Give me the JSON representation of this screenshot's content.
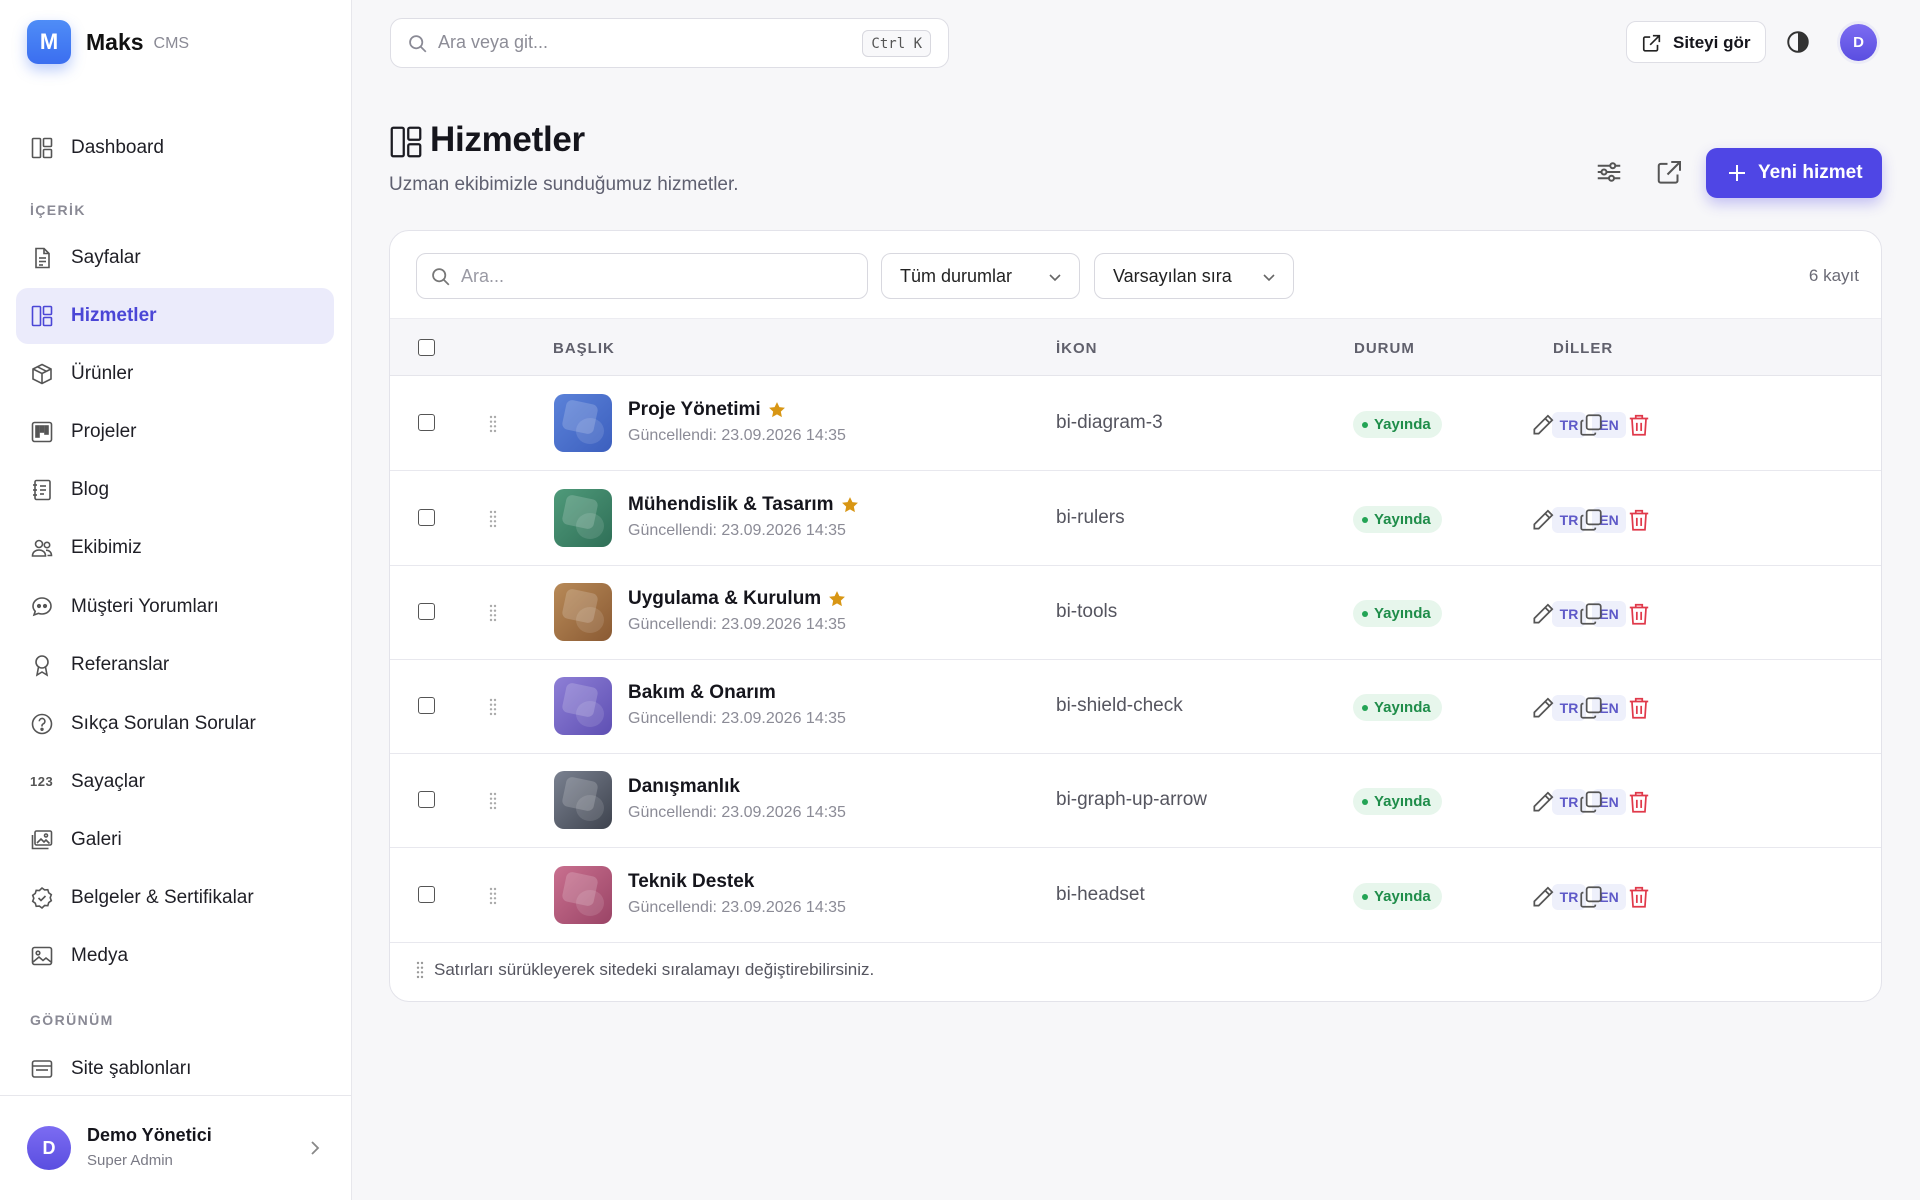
{
  "brand": {
    "logo_letter": "M",
    "name": "Maks",
    "sub": "CMS"
  },
  "sidebar": {
    "dashboard": "Dashboard",
    "section_content": "İÇERİK",
    "items": [
      {
        "label": "Sayfalar",
        "icon": "file-text-icon"
      },
      {
        "label": "Hizmetler",
        "icon": "layout-grid-icon",
        "active": true
      },
      {
        "label": "Ürünler",
        "icon": "box-icon"
      },
      {
        "label": "Projeler",
        "icon": "kanban-icon"
      },
      {
        "label": "Blog",
        "icon": "journal-icon"
      },
      {
        "label": "Ekibimiz",
        "icon": "people-icon"
      },
      {
        "label": "Müşteri Yorumları",
        "icon": "chat-quote-icon"
      },
      {
        "label": "Referanslar",
        "icon": "award-icon"
      },
      {
        "label": "Sıkça Sorulan Sorular",
        "icon": "question-circle-icon"
      },
      {
        "label": "Sayaçlar",
        "icon": "123-icon",
        "glyph": "123"
      },
      {
        "label": "Galeri",
        "icon": "images-icon"
      },
      {
        "label": "Belgeler & Sertifikalar",
        "icon": "patch-check-icon"
      },
      {
        "label": "Medya",
        "icon": "image-icon"
      }
    ],
    "section_view": "GÖRÜNÜM",
    "view_items": [
      {
        "label": "Site şablonları",
        "icon": "window-icon"
      }
    ]
  },
  "user": {
    "avatar": "D",
    "name": "Demo Yönetici",
    "role": "Super Admin"
  },
  "topbar": {
    "search_placeholder": "Ara veya git...",
    "shortcut": "Ctrl K",
    "view_site": "Siteyi gör",
    "avatar": "D"
  },
  "page": {
    "title": "Hizmetler",
    "subtitle": "Uzman ekibimizle sunduğumuz hizmetler.",
    "new_button": "Yeni hizmet"
  },
  "filters": {
    "search_placeholder": "Ara...",
    "status": "Tüm durumlar",
    "sort": "Varsayılan sıra",
    "count": "6 kayıt"
  },
  "table": {
    "columns": {
      "title": "BAŞLIK",
      "icon": "İKON",
      "status": "DURUM",
      "langs": "DİLLER"
    },
    "rows": [
      {
        "title": "Proje Yönetimi",
        "featured": true,
        "updated": "Güncellendi: 23.09.2026 14:35",
        "icon": "bi-diagram-3",
        "status": "Yayında",
        "langs": [
          "TR",
          "EN"
        ],
        "thumb": [
          "#5b82d9",
          "#3c5fbe"
        ]
      },
      {
        "title": "Mühendislik & Tasarım",
        "featured": true,
        "updated": "Güncellendi: 23.09.2026 14:35",
        "icon": "bi-rulers",
        "status": "Yayında",
        "langs": [
          "TR",
          "EN"
        ],
        "thumb": [
          "#4f9a7a",
          "#2f6f57"
        ]
      },
      {
        "title": "Uygulama & Kurulum",
        "featured": true,
        "updated": "Güncellendi: 23.09.2026 14:35",
        "icon": "bi-tools",
        "status": "Yayında",
        "langs": [
          "TR",
          "EN"
        ],
        "thumb": [
          "#b88a58",
          "#8a5a33"
        ]
      },
      {
        "title": "Bakım & Onarım",
        "featured": false,
        "updated": "Güncellendi: 23.09.2026 14:35",
        "icon": "bi-shield-check",
        "status": "Yayında",
        "langs": [
          "TR",
          "EN"
        ],
        "thumb": [
          "#8e7fd6",
          "#5e4fb3"
        ]
      },
      {
        "title": "Danışmanlık",
        "featured": false,
        "updated": "Güncellendi: 23.09.2026 14:35",
        "icon": "bi-graph-up-arrow",
        "status": "Yayında",
        "langs": [
          "TR",
          "EN"
        ],
        "thumb": [
          "#7a8190",
          "#3e434e"
        ]
      },
      {
        "title": "Teknik Destek",
        "featured": false,
        "updated": "Güncellendi: 23.09.2026 14:35",
        "icon": "bi-headset",
        "status": "Yayında",
        "langs": [
          "TR",
          "EN"
        ],
        "thumb": [
          "#c9708f",
          "#9a4466"
        ]
      }
    ],
    "footnote": "Satırları sürükleyerek sitedeki sıralamayı değiştirebilirsiniz."
  },
  "colors": {
    "accent": "#4f46e5",
    "status_green": "#1f8d4a",
    "delete_red": "#e0394a",
    "star": "#d89614"
  }
}
